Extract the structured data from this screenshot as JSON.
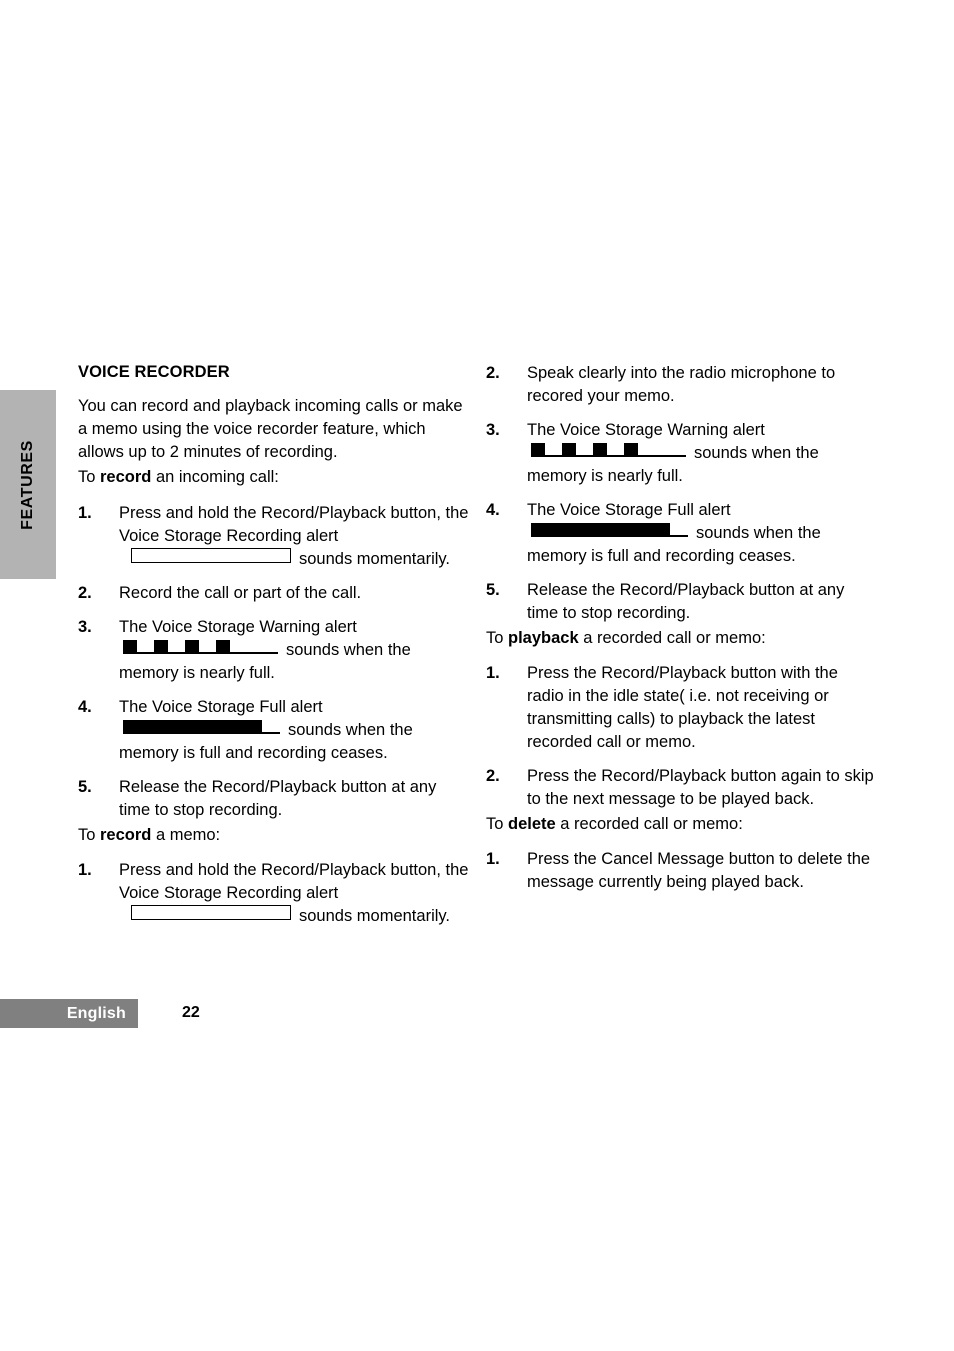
{
  "side_tab": {
    "label": "FEATURES"
  },
  "footer": {
    "language": "English",
    "page_number": "22",
    "band_color": "#808080",
    "tab_color": "#b3b3b3"
  },
  "left_column": {
    "section_title": "VOICE RECORDER",
    "intro": "You can record and playback incoming calls or make a memo using the voice recorder feature, which allows up to 2 minutes of recording.",
    "lead_in_1_prefix": "To ",
    "lead_in_1_bold": "record",
    "lead_in_1_suffix": " an incoming call:",
    "steps_1": [
      {
        "num": "1.",
        "text": "Press and hold the Record/Playback button, the Voice Storage Recording alert",
        "tone": "hollow-bar",
        "tone_tail": "sounds momentarily."
      },
      {
        "num": "2.",
        "text": "Record the call or part of the call."
      },
      {
        "num": "3.",
        "text": "The Voice Storage Warning alert",
        "tone": "four-pulses",
        "tone_tail": "sounds when the",
        "text_after": "memory is nearly full."
      },
      {
        "num": "4.",
        "text": "The Voice Storage Full alert",
        "tone": "solid-bar",
        "tone_tail": "sounds when the",
        "text_after": "memory is full and recording ceases."
      },
      {
        "num": "5.",
        "text": "Release the Record/Playback button at any time to stop recording."
      }
    ],
    "lead_in_2_prefix": "To ",
    "lead_in_2_bold": "record",
    "lead_in_2_suffix": " a memo:",
    "steps_2": [
      {
        "num": "1.",
        "text": "Press and hold the Record/Playback button, the Voice Storage Recording alert",
        "tone": "hollow-bar",
        "tone_tail": "sounds momentarily."
      }
    ]
  },
  "right_column": {
    "steps_1": [
      {
        "num": "2.",
        "text": "Speak clearly into the radio microphone to recored your memo."
      },
      {
        "num": "3.",
        "text": "The Voice Storage Warning alert",
        "tone": "four-pulses",
        "tone_tail": "sounds when the",
        "text_after": "memory is nearly full."
      },
      {
        "num": "4.",
        "text": "The Voice Storage Full alert",
        "tone": "solid-bar",
        "tone_tail": "sounds when the",
        "text_after": "memory is full and recording ceases."
      },
      {
        "num": "5.",
        "text": "Release the Record/Playback button at any time to stop recording."
      }
    ],
    "lead_in_1_prefix": "To ",
    "lead_in_1_bold": "playback",
    "lead_in_1_suffix": " a recorded call or memo:",
    "steps_2": [
      {
        "num": "1.",
        "text": "Press the Record/Playback button with the radio in the idle state( i.e. not receiving or transmitting calls) to playback the latest recorded call or memo."
      },
      {
        "num": "2.",
        "text": "Press the Record/Playback button again to skip to the next message to be played back."
      }
    ],
    "lead_in_2_prefix": "To ",
    "lead_in_2_bold": "delete",
    "lead_in_2_suffix": " a recorded call or memo:",
    "steps_3": [
      {
        "num": "1.",
        "text": "Press the Cancel Message button to delete the message currently being played back."
      }
    ]
  }
}
